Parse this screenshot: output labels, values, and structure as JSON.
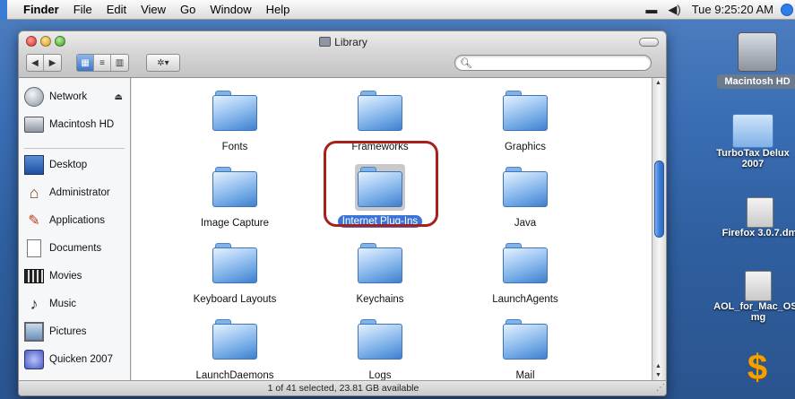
{
  "menubar": {
    "app": "Finder",
    "items": [
      "File",
      "Edit",
      "View",
      "Go",
      "Window",
      "Help"
    ],
    "clock": "Tue 9:25:20 AM"
  },
  "window": {
    "title": "Library",
    "search_placeholder": "",
    "status": "1 of 41 selected, 23.81 GB available"
  },
  "sidebar": {
    "devices": [
      {
        "label": "Network",
        "icon": "network-icon"
      },
      {
        "label": "Macintosh HD",
        "icon": "hard-drive-icon"
      }
    ],
    "places": [
      {
        "label": "Desktop",
        "icon": "desktop-icon"
      },
      {
        "label": "Administrator",
        "icon": "home-icon"
      },
      {
        "label": "Applications",
        "icon": "applications-icon"
      },
      {
        "label": "Documents",
        "icon": "documents-icon"
      },
      {
        "label": "Movies",
        "icon": "movies-icon"
      },
      {
        "label": "Music",
        "icon": "music-icon"
      },
      {
        "label": "Pictures",
        "icon": "pictures-icon"
      },
      {
        "label": "Quicken 2007",
        "icon": "quicken-icon"
      }
    ]
  },
  "files": [
    {
      "name": "Fonts"
    },
    {
      "name": "Frameworks"
    },
    {
      "name": "Graphics"
    },
    {
      "name": "Image Capture"
    },
    {
      "name": "Internet Plug-Ins",
      "selected": true
    },
    {
      "name": "Java"
    },
    {
      "name": "Keyboard Layouts"
    },
    {
      "name": "Keychains"
    },
    {
      "name": "LaunchAgents"
    },
    {
      "name": "LaunchDaemons"
    },
    {
      "name": "Logs"
    },
    {
      "name": "Mail"
    }
  ],
  "desktop": {
    "items": [
      {
        "label": "Macintosh HD"
      },
      {
        "label": "TurboTax Delux 2007"
      },
      {
        "label": "Firefox 3.0.7.dm"
      },
      {
        "label": "AOL_for_Mac_OS_ mg"
      },
      {
        "label": ""
      }
    ]
  },
  "colors": {
    "selection": "#3b74d6",
    "highlight_ring": "#a8201a",
    "desktop": "#3a6db4"
  }
}
